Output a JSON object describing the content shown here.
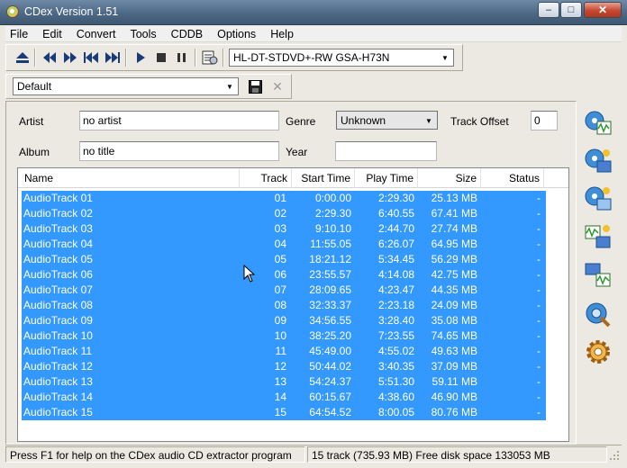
{
  "window": {
    "title": "CDex Version 1.51",
    "min_glyph": "–",
    "max_glyph": "□",
    "close_glyph": "✕"
  },
  "menu": [
    "File",
    "Edit",
    "Convert",
    "Tools",
    "CDDB",
    "Options",
    "Help"
  ],
  "toolbar": {
    "drive": "HL-DT-STDVD+-RW GSA-H73N"
  },
  "profile": {
    "value": "Default"
  },
  "form": {
    "artist_label": "Artist",
    "artist_value": "no artist",
    "album_label": "Album",
    "album_value": "no title",
    "genre_label": "Genre",
    "genre_value": "Unknown",
    "year_label": "Year",
    "year_value": "",
    "offset_label": "Track Offset",
    "offset_value": "0"
  },
  "tracks": {
    "columns": [
      "Name",
      "Track",
      "Start Time",
      "Play Time",
      "Size",
      "Status"
    ],
    "rows": [
      [
        "AudioTrack 01",
        "01",
        "0:00.00",
        "2:29.30",
        "25.13 MB",
        "-"
      ],
      [
        "AudioTrack 02",
        "02",
        "2:29.30",
        "6:40.55",
        "67.41 MB",
        "-"
      ],
      [
        "AudioTrack 03",
        "03",
        "9:10.10",
        "2:44.70",
        "27.74 MB",
        "-"
      ],
      [
        "AudioTrack 04",
        "04",
        "11:55.05",
        "6:26.07",
        "64.95 MB",
        "-"
      ],
      [
        "AudioTrack 05",
        "05",
        "18:21.12",
        "5:34.45",
        "56.29 MB",
        "-"
      ],
      [
        "AudioTrack 06",
        "06",
        "23:55.57",
        "4:14.08",
        "42.75 MB",
        "-"
      ],
      [
        "AudioTrack 07",
        "07",
        "28:09.65",
        "4:23.47",
        "44.35 MB",
        "-"
      ],
      [
        "AudioTrack 08",
        "08",
        "32:33.37",
        "2:23.18",
        "24.09 MB",
        "-"
      ],
      [
        "AudioTrack 09",
        "09",
        "34:56.55",
        "3:28.40",
        "35.08 MB",
        "-"
      ],
      [
        "AudioTrack 10",
        "10",
        "38:25.20",
        "7:23.55",
        "74.65 MB",
        "-"
      ],
      [
        "AudioTrack 11",
        "11",
        "45:49.00",
        "4:55.02",
        "49.63 MB",
        "-"
      ],
      [
        "AudioTrack 12",
        "12",
        "50:44.02",
        "3:40.35",
        "37.09 MB",
        "-"
      ],
      [
        "AudioTrack 13",
        "13",
        "54:24.37",
        "5:51.30",
        "59.11 MB",
        "-"
      ],
      [
        "AudioTrack 14",
        "14",
        "60:15.67",
        "4:38.60",
        "46.90 MB",
        "-"
      ],
      [
        "AudioTrack 15",
        "15",
        "64:54.52",
        "8:00.05",
        "80.76 MB",
        "-"
      ]
    ]
  },
  "status": {
    "help": "Press F1 for help on the CDex audio CD extractor program",
    "info": "15 track (735.93 MB) Free disk space 133053 MB"
  },
  "colors": {
    "selection": "#3399ff",
    "titlebar": "#4d6885"
  }
}
